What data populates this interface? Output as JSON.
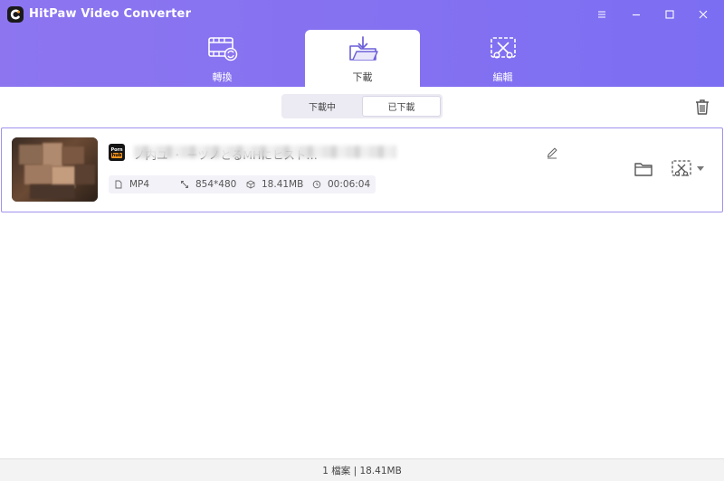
{
  "app": {
    "title": "HitPaw Video Converter"
  },
  "tabs": [
    {
      "label": "轉換",
      "icon": "convert-film-icon"
    },
    {
      "label": "下載",
      "icon": "download-folder-icon"
    },
    {
      "label": "編輯",
      "icon": "edit-scissors-icon"
    }
  ],
  "active_tab": "下載",
  "segment": {
    "downloading": "下載中",
    "downloaded": "已下載",
    "selected": "已下載"
  },
  "item": {
    "source_badge": {
      "top": "Porn",
      "bottom": "hub"
    },
    "file_name_visible": "ノ内ユ ・ ーツノとるMHにヒスト…",
    "format": "MP4",
    "resolution": "854*480",
    "size": "18.41MB",
    "duration": "00:06:04"
  },
  "status": {
    "text": "1 檔案 | 18.41MB"
  },
  "colors": {
    "accent": "#7c6ef2",
    "header_start": "#8d75f0",
    "border": "#9f93ee"
  }
}
